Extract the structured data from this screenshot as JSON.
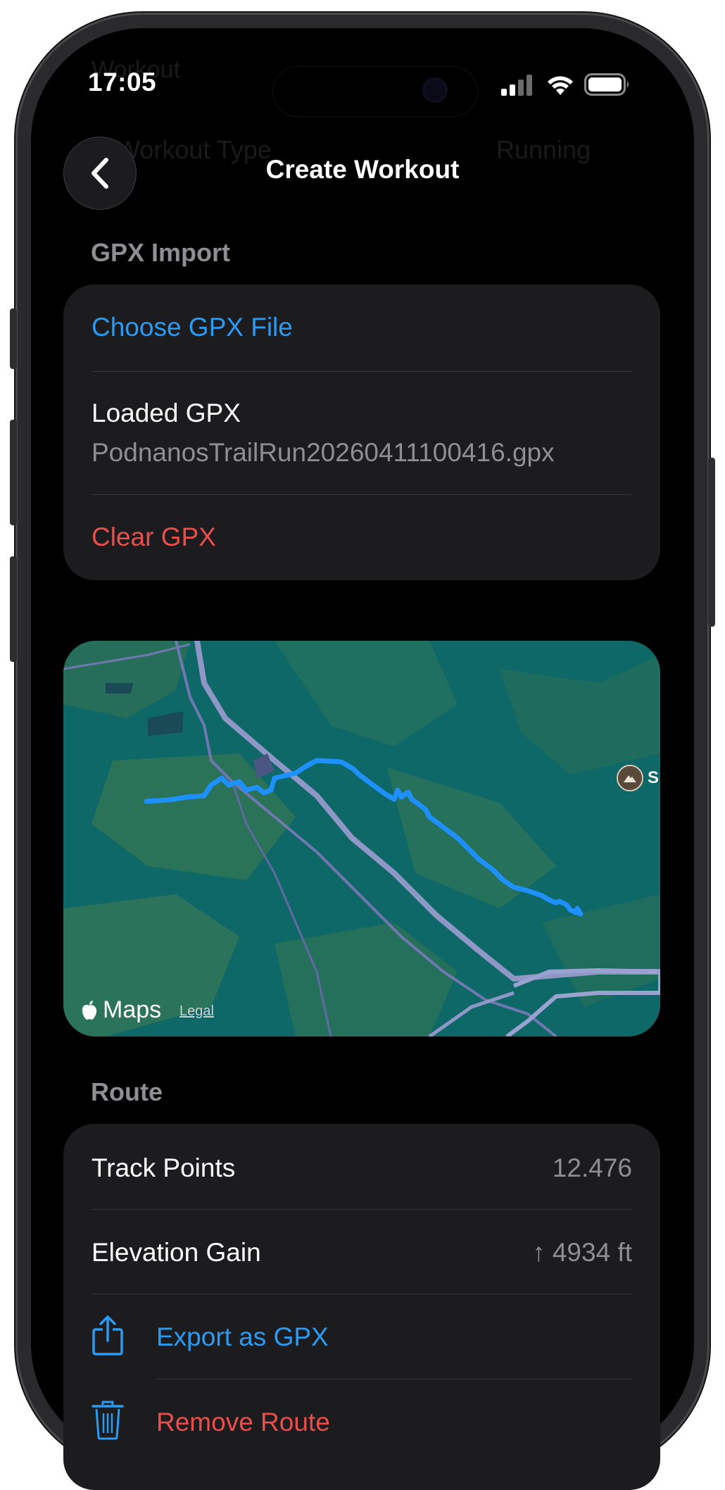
{
  "status_bar": {
    "time": "17:05"
  },
  "background_ghost": {
    "title": "Workout",
    "row_label": "Workout Type",
    "row_value": "Running"
  },
  "nav": {
    "title": "Create Workout"
  },
  "gpx_import": {
    "header": "GPX Import",
    "choose_label": "Choose GPX File",
    "loaded_label": "Loaded GPX",
    "loaded_file": "PodnanosTrailRun20260411100416.gpx",
    "clear_label": "Clear GPX"
  },
  "map": {
    "brand": "Maps",
    "legal": "Legal",
    "poi_label": "S"
  },
  "route": {
    "header": "Route",
    "track_points_label": "Track Points",
    "track_points_value": "12.476",
    "elevation_label": "Elevation Gain",
    "elevation_value": "↑ 4934 ft",
    "export_label": "Export as GPX",
    "remove_label": "Remove Route"
  },
  "icons": {
    "back": "chevron-left-icon",
    "share": "share-icon",
    "trash": "trash-icon",
    "apple": "apple-logo-icon",
    "mountain": "mountain-icon"
  },
  "colors": {
    "accent_blue": "#2a9bf4",
    "destructive_red": "#eb4d4b",
    "route_line": "#1e90ff"
  }
}
